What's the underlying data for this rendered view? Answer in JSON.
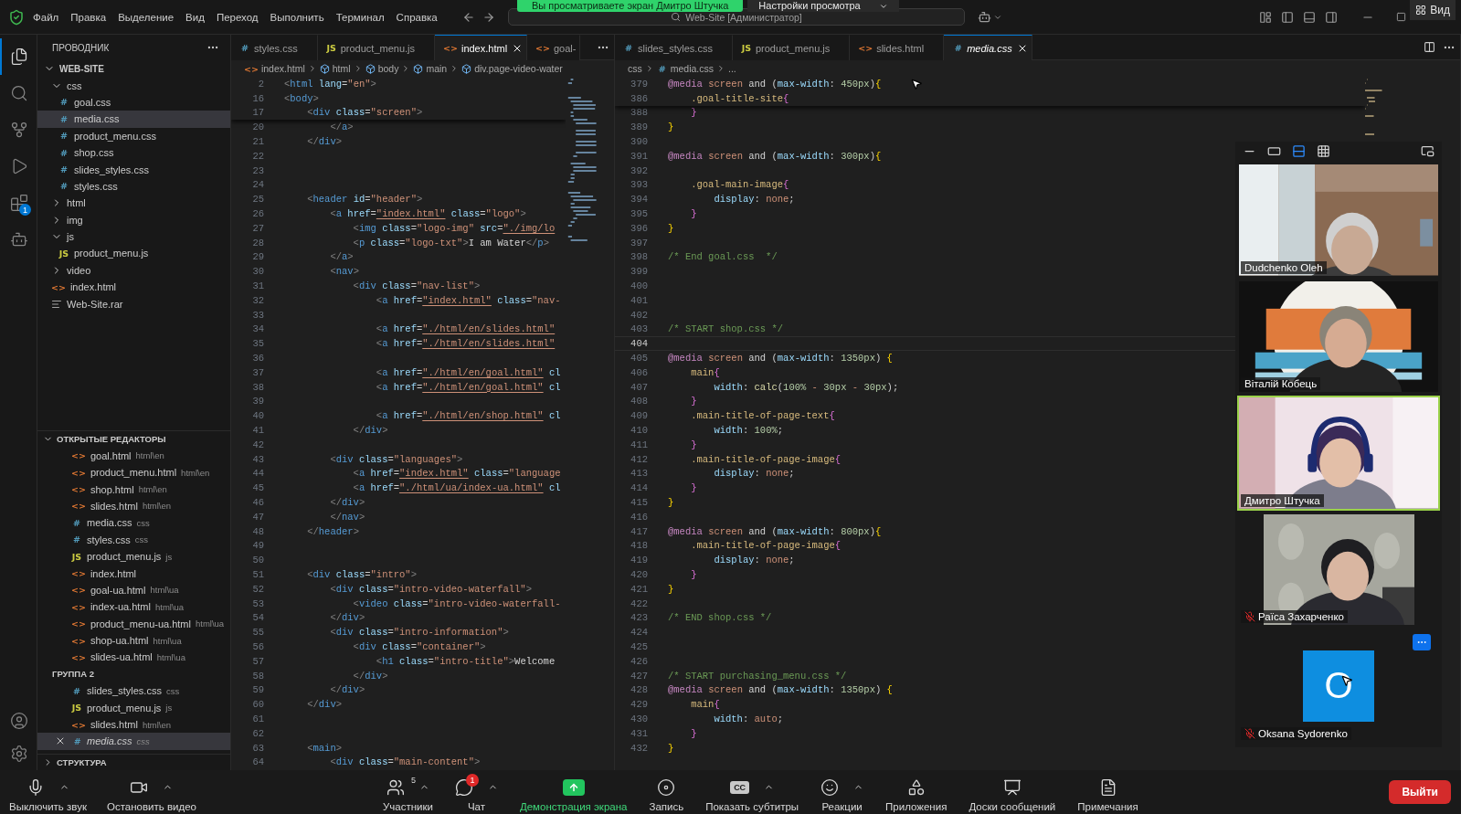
{
  "title_bar": {
    "menu": [
      "Файл",
      "Правка",
      "Выделение",
      "Вид",
      "Переход",
      "Выполнить",
      "Терминал",
      "Справка"
    ],
    "search": "Web-Site [Администратор]"
  },
  "activity_bar": {
    "items": [
      {
        "kind": "explorer",
        "selected": true
      },
      {
        "kind": "search",
        "selected": false
      },
      {
        "kind": "source_control",
        "selected": false
      },
      {
        "kind": "run",
        "selected": false
      },
      {
        "kind": "extensions",
        "selected": false,
        "badge": "1"
      },
      {
        "kind": "robot",
        "selected": false
      }
    ],
    "bottom": [
      {
        "kind": "account"
      },
      {
        "kind": "settings"
      }
    ]
  },
  "sidebar": {
    "title": "ПРОВОДНИК",
    "tree": [
      {
        "label": "WEB-SITE",
        "kind": "root",
        "expanded": true,
        "selected": false,
        "children": [
          {
            "label": "css",
            "kind": "folder",
            "expanded": true,
            "selected": false,
            "children": [
              {
                "label": "goal.css",
                "kind": "css",
                "icon": "#",
                "selected": false
              },
              {
                "label": "media.css",
                "kind": "css",
                "icon": "#",
                "selected": true
              },
              {
                "label": "product_menu.css",
                "kind": "css",
                "icon": "#",
                "selected": false
              },
              {
                "label": "shop.css",
                "kind": "css",
                "icon": "#",
                "selected": false
              },
              {
                "label": "slides_styles.css",
                "kind": "css",
                "icon": "#",
                "selected": false
              },
              {
                "label": "styles.css",
                "kind": "css",
                "icon": "#",
                "selected": false
              }
            ]
          },
          {
            "label": "html",
            "kind": "folder",
            "expanded": false,
            "selected": false
          },
          {
            "label": "img",
            "kind": "folder",
            "expanded": false,
            "selected": false
          },
          {
            "label": "js",
            "kind": "folder",
            "expanded": true,
            "selected": false,
            "children": [
              {
                "label": "product_menu.js",
                "kind": "js",
                "icon": "JS",
                "selected": false
              }
            ]
          },
          {
            "label": "video",
            "kind": "folder",
            "expanded": false,
            "selected": false
          },
          {
            "label": "index.html",
            "kind": "html",
            "icon": "<>",
            "selected": false
          },
          {
            "label": "Web-Site.rar",
            "kind": "archive",
            "selected": false
          }
        ]
      }
    ],
    "open_editors": {
      "title": "ОТКРЫТЫЕ РЕДАКТОРЫ",
      "expanded": true,
      "groups": [
        {
          "items": [
            {
              "name": "goal.html",
              "path": "html\\en",
              "kind": "html",
              "icon": "<>",
              "selected": false
            },
            {
              "name": "product_menu.html",
              "path": "html\\en",
              "kind": "html",
              "icon": "<>",
              "selected": false
            },
            {
              "name": "shop.html",
              "path": "html\\en",
              "kind": "html",
              "icon": "<>",
              "selected": false
            },
            {
              "name": "slides.html",
              "path": "html\\en",
              "kind": "html",
              "icon": "<>",
              "selected": false
            },
            {
              "name": "media.css",
              "path": "css",
              "kind": "css",
              "icon": "#",
              "selected": false
            },
            {
              "name": "styles.css",
              "path": "css",
              "kind": "css",
              "icon": "#",
              "selected": false
            },
            {
              "name": "product_menu.js",
              "path": "js",
              "kind": "js",
              "icon": "JS",
              "selected": false
            },
            {
              "name": "index.html",
              "kind": "html",
              "icon": "<>",
              "selected": false
            },
            {
              "name": "goal-ua.html",
              "path": "html\\ua",
              "kind": "html",
              "icon": "<>",
              "selected": false
            },
            {
              "name": "index-ua.html",
              "path": "html\\ua",
              "kind": "html",
              "icon": "<>",
              "selected": false
            },
            {
              "name": "product_menu-ua.html",
              "path": "html\\ua",
              "kind": "html",
              "icon": "<>",
              "selected": false
            },
            {
              "name": "shop-ua.html",
              "path": "html\\ua",
              "kind": "html",
              "icon": "<>",
              "selected": false
            },
            {
              "name": "slides-ua.html",
              "path": "html\\ua",
              "kind": "html",
              "icon": "<>",
              "selected": false
            }
          ]
        },
        {
          "title": "ГРУППА 2",
          "items": [
            {
              "name": "slides_styles.css",
              "path": "css",
              "kind": "css",
              "icon": "#",
              "selected": false
            },
            {
              "name": "product_menu.js",
              "path": "js",
              "kind": "js",
              "icon": "JS",
              "selected": false
            },
            {
              "name": "slides.html",
              "path": "html\\en",
              "kind": "html",
              "icon": "<>",
              "selected": false
            },
            {
              "name": "media.css",
              "path": "css",
              "kind": "css",
              "icon": "#",
              "selected": true
            }
          ]
        }
      ]
    },
    "outline": {
      "title": "СТРУКТУРА",
      "expanded": false
    }
  },
  "editors": [
    {
      "kind": "markup",
      "tabs": [
        {
          "label": "styles.css",
          "kind": "css",
          "icon": "#",
          "selected": false,
          "preview": false
        },
        {
          "label": "product_menu.js",
          "kind": "js",
          "icon": "JS",
          "selected": false,
          "preview": false
        },
        {
          "label": "index.html",
          "kind": "html",
          "icon": "<>",
          "selected": true,
          "preview": false
        },
        {
          "label": "goal-",
          "kind": "html",
          "icon": "<>",
          "selected": false,
          "preview": false
        }
      ],
      "breadcrumb": [
        {
          "label": "index.html",
          "kind": "html",
          "icon": "<>"
        },
        {
          "label": "html",
          "kind": "element"
        },
        {
          "label": "body",
          "kind": "element"
        },
        {
          "label": "main",
          "kind": "element"
        },
        {
          "label": "div.page-video-water",
          "kind": "element"
        }
      ],
      "sticky": [
        {
          "n": "2",
          "text": "<html lang=\"en\">"
        },
        {
          "n": "16",
          "text": "<body>"
        },
        {
          "n": "17",
          "text": "    <div class=\"screen\">"
        }
      ],
      "lines": [
        {
          "n": "20",
          "text": "        </a>"
        },
        {
          "n": "21",
          "text": "    </div>"
        },
        {
          "n": "22"
        },
        {
          "n": "23"
        },
        {
          "n": "24"
        },
        {
          "n": "25",
          "text": "    <header id=\"header\">"
        },
        {
          "n": "26",
          "text": "        <a href=\"index.html\" class=\"logo\">"
        },
        {
          "n": "27",
          "text": "            <img class=\"logo-img\" src=\"./img/lo"
        },
        {
          "n": "28",
          "text": "            <p class=\"logo-txt\">I am Water</p>"
        },
        {
          "n": "29",
          "text": "        </a>"
        },
        {
          "n": "30",
          "text": "        <nav>"
        },
        {
          "n": "31",
          "text": "            <div class=\"nav-list\">"
        },
        {
          "n": "32",
          "text": "                <a href=\"index.html\" class=\"nav-"
        },
        {
          "n": "33"
        },
        {
          "n": "34",
          "text": "                <a href=\"./html/en/slides.html\""
        },
        {
          "n": "35",
          "text": "                <a href=\"./html/en/slides.html\""
        },
        {
          "n": "36"
        },
        {
          "n": "37",
          "text": "                <a href=\"./html/en/goal.html\" cl"
        },
        {
          "n": "38",
          "text": "                <a href=\"./html/en/goal.html\" cl"
        },
        {
          "n": "39"
        },
        {
          "n": "40",
          "text": "                <a href=\"./html/en/shop.html\" cl"
        },
        {
          "n": "41",
          "text": "            </div>"
        },
        {
          "n": "42"
        },
        {
          "n": "43",
          "text": "        <div class=\"languages\">"
        },
        {
          "n": "44",
          "text": "            <a href=\"index.html\" class=\"language"
        },
        {
          "n": "45",
          "text": "            <a href=\"./html/ua/index-ua.html\" cl"
        },
        {
          "n": "46",
          "text": "        </div>"
        },
        {
          "n": "47",
          "text": "        </nav>"
        },
        {
          "n": "48",
          "text": "    </header>"
        },
        {
          "n": "49"
        },
        {
          "n": "50"
        },
        {
          "n": "51",
          "text": "    <div class=\"intro\">"
        },
        {
          "n": "52",
          "text": "        <div class=\"intro-video-waterfall\">"
        },
        {
          "n": "53",
          "text": "            <video class=\"intro-video-waterfall-"
        },
        {
          "n": "54",
          "text": "        </div>"
        },
        {
          "n": "55",
          "text": "        <div class=\"intro-information\">"
        },
        {
          "n": "56",
          "text": "            <div class=\"container\">"
        },
        {
          "n": "57",
          "text": "                <h1 class=\"intro-title\">Welcome"
        },
        {
          "n": "58",
          "text": "            </div>"
        },
        {
          "n": "59",
          "text": "        </div>"
        },
        {
          "n": "60",
          "text": "    </div>"
        },
        {
          "n": "61"
        },
        {
          "n": "62"
        },
        {
          "n": "63",
          "text": "    <main>"
        },
        {
          "n": "64",
          "text": "        <div class=\"main-content\">"
        }
      ]
    },
    {
      "kind": "stylesheet",
      "tabs": [
        {
          "label": "slides_styles.css",
          "kind": "css",
          "icon": "#",
          "selected": false,
          "preview": false
        },
        {
          "label": "product_menu.js",
          "kind": "js",
          "icon": "JS",
          "selected": false,
          "preview": false
        },
        {
          "label": "slides.html",
          "kind": "html",
          "icon": "<>",
          "selected": false,
          "preview": false
        },
        {
          "label": "media.css",
          "kind": "css",
          "icon": "#",
          "selected": true,
          "preview": true
        }
      ],
      "breadcrumb": [
        {
          "label": "css",
          "kind": "folder"
        },
        {
          "label": "media.css",
          "kind": "css",
          "icon": "#"
        },
        {
          "label": "...",
          "kind": "more"
        }
      ],
      "sticky": [
        {
          "n": "379",
          "text": "@media screen and (max-width: 450px){"
        },
        {
          "n": "386",
          "text": "    .goal-title-site{"
        }
      ],
      "lines": [
        {
          "n": "388",
          "current": false,
          "text": "    }"
        },
        {
          "n": "389",
          "current": false,
          "text": "}"
        },
        {
          "n": "390",
          "current": false
        },
        {
          "n": "391",
          "current": false,
          "text": "@media screen and (max-width: 300px){"
        },
        {
          "n": "392",
          "current": false
        },
        {
          "n": "393",
          "current": false,
          "text": "    .goal-main-image{"
        },
        {
          "n": "394",
          "current": false,
          "text": "        display: none;"
        },
        {
          "n": "395",
          "current": false,
          "text": "    }"
        },
        {
          "n": "396",
          "current": false,
          "text": "}"
        },
        {
          "n": "397",
          "current": false
        },
        {
          "n": "398",
          "current": false,
          "text": "/* End goal.css  */"
        },
        {
          "n": "399",
          "current": false
        },
        {
          "n": "400",
          "current": false
        },
        {
          "n": "401",
          "current": false
        },
        {
          "n": "402",
          "current": false
        },
        {
          "n": "403",
          "current": false,
          "text": "/* START shop.css */"
        },
        {
          "n": "404",
          "current": true
        },
        {
          "n": "405",
          "current": false,
          "text": "@media screen and (max-width: 1350px) {"
        },
        {
          "n": "406",
          "current": false,
          "text": "    main{"
        },
        {
          "n": "407",
          "current": false,
          "text": "        width: calc(100% - 30px - 30px);"
        },
        {
          "n": "408",
          "current": false,
          "text": "    }"
        },
        {
          "n": "409",
          "current": false,
          "text": "    .main-title-of-page-text{"
        },
        {
          "n": "410",
          "current": false,
          "text": "        width: 100%;"
        },
        {
          "n": "411",
          "current": false,
          "text": "    }"
        },
        {
          "n": "412",
          "current": false,
          "text": "    .main-title-of-page-image{"
        },
        {
          "n": "413",
          "current": false,
          "text": "        display: none;"
        },
        {
          "n": "414",
          "current": false,
          "text": "    }"
        },
        {
          "n": "415",
          "current": false,
          "text": "}"
        },
        {
          "n": "416",
          "current": false
        },
        {
          "n": "417",
          "current": false,
          "text": "@media screen and (max-width: 800px){"
        },
        {
          "n": "418",
          "current": false,
          "text": "    .main-title-of-page-image{"
        },
        {
          "n": "419",
          "current": false,
          "text": "        display: none;"
        },
        {
          "n": "420",
          "current": false,
          "text": "    }"
        },
        {
          "n": "421",
          "current": false,
          "text": "}"
        },
        {
          "n": "422",
          "current": false
        },
        {
          "n": "423",
          "current": false,
          "text": "/* END shop.css */"
        },
        {
          "n": "424",
          "current": false
        },
        {
          "n": "425",
          "current": false
        },
        {
          "n": "426",
          "current": false
        },
        {
          "n": "427",
          "current": false,
          "text": "/* START purchasing_menu.css */"
        },
        {
          "n": "428",
          "current": false,
          "text": "@media screen and (max-width: 1350px) {"
        },
        {
          "n": "429",
          "current": false,
          "text": "    main{"
        },
        {
          "n": "430",
          "current": false,
          "text": "        width: auto;"
        },
        {
          "n": "431",
          "current": false,
          "text": "    }"
        },
        {
          "n": "432",
          "current": false,
          "text": "}"
        }
      ]
    }
  ],
  "zoom": {
    "banner": "Вы просматриваете экран Дмитро Штучка",
    "view_settings": "Настройки просмотра",
    "view_button": "Вид",
    "panel": {
      "modes": [
        {
          "kind": "minimize",
          "selected": false
        },
        {
          "kind": "strip",
          "selected": false
        },
        {
          "kind": "speaker",
          "selected": true
        },
        {
          "kind": "gallery",
          "selected": false
        }
      ],
      "participants": [
        {
          "name": "Dudchenko Oleh",
          "kind": "video",
          "muted": false,
          "speaking": false
        },
        {
          "name": "Віталій Кобець",
          "kind": "video",
          "muted": false,
          "speaking": false
        },
        {
          "name": "Дмитро Штучка",
          "kind": "video",
          "muted": false,
          "speaking": true
        },
        {
          "name": "Раїса Захарченко",
          "kind": "video",
          "muted": true,
          "speaking": false
        },
        {
          "name": "Oksana Sydorenko",
          "kind": "avatar",
          "initial": "O",
          "muted": true,
          "speaking": false
        }
      ]
    },
    "toolbar": {
      "left": [
        {
          "label": "Выключить звук",
          "kind": "mic",
          "caret": true,
          "active": false
        },
        {
          "label": "Остановить видео",
          "kind": "camera",
          "caret": true,
          "active": false
        }
      ],
      "center": [
        {
          "label": "Участники",
          "kind": "participants",
          "count": "5",
          "caret": true,
          "active": false
        },
        {
          "label": "Чат",
          "kind": "chat",
          "badge": "1",
          "caret": true,
          "active": false
        },
        {
          "label": "Демонстрация экрана",
          "kind": "share",
          "caret": false,
          "active": true
        },
        {
          "label": "Запись",
          "kind": "record",
          "caret": false,
          "active": false
        },
        {
          "label": "Показать субтитры",
          "kind": "captions",
          "icon_text": "CC",
          "caret": true,
          "active": false
        },
        {
          "label": "Реакции",
          "kind": "reactions",
          "caret": true,
          "active": false
        },
        {
          "label": "Приложения",
          "kind": "apps",
          "caret": false,
          "active": false
        },
        {
          "label": "Доски сообщений",
          "kind": "whiteboards",
          "caret": false,
          "active": false
        },
        {
          "label": "Примечания",
          "kind": "notes",
          "caret": false,
          "active": false
        }
      ],
      "leave": "Выйти"
    }
  }
}
